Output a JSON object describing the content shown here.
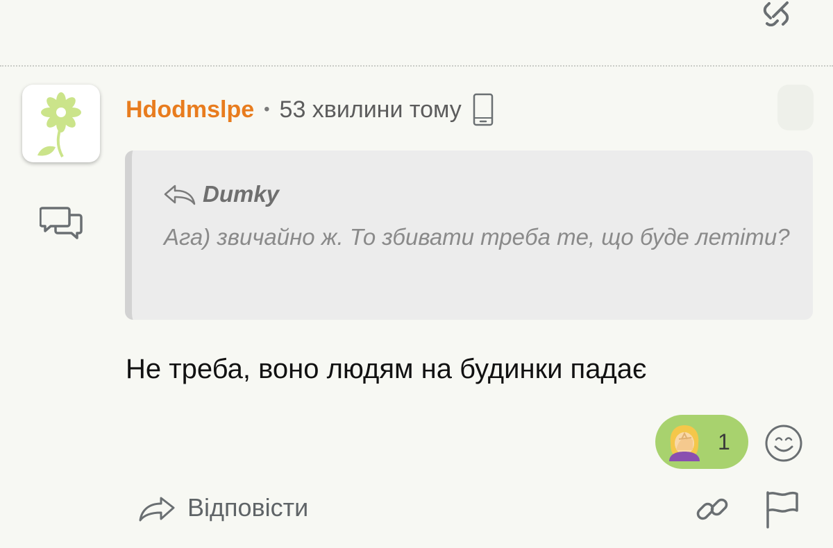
{
  "comment": {
    "author": "Hdodmslpe",
    "separator": "•",
    "timestamp": "53 хвилини тому",
    "quote": {
      "author": "Dumky",
      "text": "Ага) звичайно ж. То збивати треба те, що буде летіти?"
    },
    "body": "Не треба, воно людям на будинки падає",
    "reaction": {
      "emoji": "face-palm-woman",
      "count": "1"
    },
    "actions": {
      "reply_label": "Відповісти"
    }
  },
  "icons": {
    "top": "link-icon",
    "device": "smartphone-icon",
    "chat": "chat-bubbles-icon",
    "quote_reply": "reply-back-icon",
    "add_reaction": "smile-icon",
    "reply": "reply-arrow-icon",
    "link": "link-icon",
    "flag": "flag-icon"
  },
  "colors": {
    "author": "#e87c1e",
    "reaction_bg": "#a8d26e",
    "background": "#f7f8f3"
  }
}
